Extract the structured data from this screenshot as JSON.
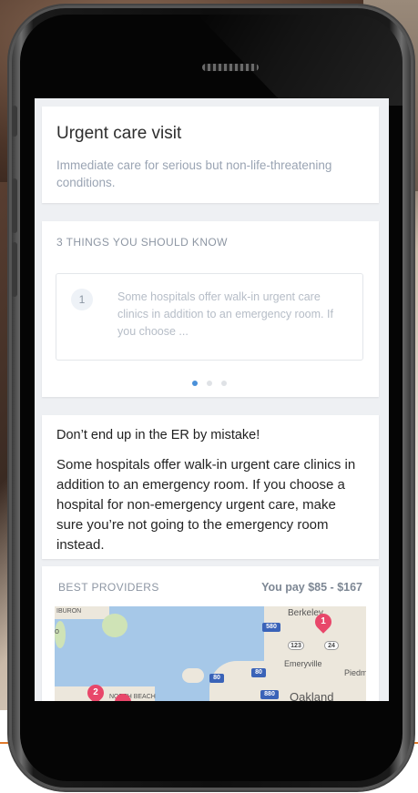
{
  "card_visit": {
    "title": "Urgent care visit",
    "subtitle": "Immediate care for serious but non-life-threatening conditions."
  },
  "tips": {
    "heading": "3 THINGS YOU SHOULD KNOW",
    "items": [
      {
        "number": "1",
        "text": "Some hospitals offer walk-in urgent care clinics in addition to an emergency room. If you choose ..."
      }
    ],
    "pagination": {
      "count": 3,
      "active_index": 0
    }
  },
  "warning": {
    "title": "Don’t end up in the ER by mistake!",
    "body": "Some hospitals offer walk-in urgent care clinics in addition to an emergency room. If you choose a hospital for non-emergency urgent care, make sure you’re not going to the emergency room instead."
  },
  "providers": {
    "heading": "BEST PROVIDERS",
    "price_label": "You pay $85 - $167",
    "map": {
      "labels": {
        "berkeley": "Berkeley",
        "emeryville": "Emeryville",
        "oakland": "Oakland",
        "piedmont": "Piedm",
        "tiburon": "IBURON",
        "north_beach": "NORTH BEACH",
        "o": "o"
      },
      "shields": {
        "i580": "580",
        "r123": "123",
        "r24": "24",
        "i80a": "80",
        "i80b": "80",
        "i880": "880"
      },
      "pins": [
        "1",
        "2"
      ]
    }
  },
  "colors": {
    "accent": "#4a90d9",
    "pin": "#e8476a",
    "muted_text": "#9aa4b3",
    "water": "#a6c8e8"
  }
}
